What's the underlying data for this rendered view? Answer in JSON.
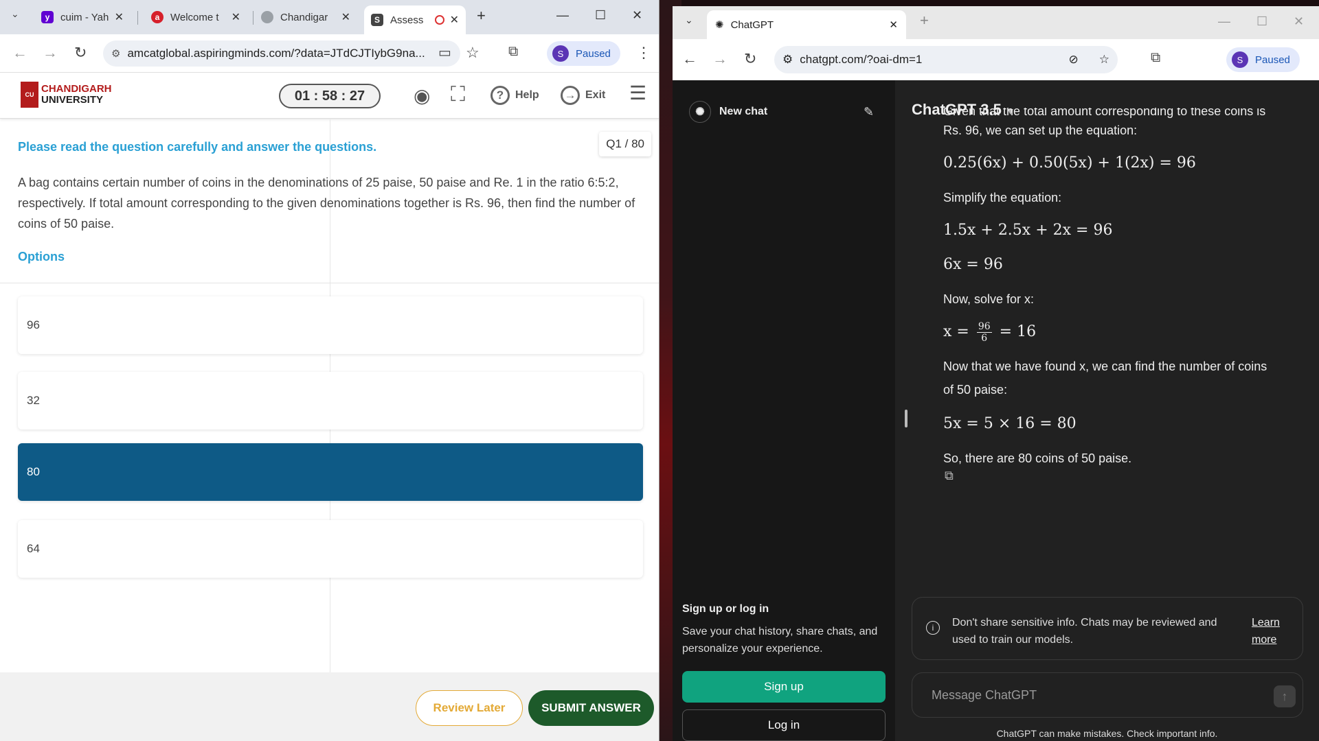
{
  "left_browser": {
    "tabs": [
      {
        "title": "cuim - Yah",
        "icon": "yahoo-icon"
      },
      {
        "title": "Welcome t",
        "icon": "aspiring-minds-icon"
      },
      {
        "title": "Chandigar",
        "icon": "globe-icon"
      },
      {
        "title": "Assess",
        "icon": "s-icon",
        "active": true
      }
    ],
    "url": "amcatglobal.aspiringminds.com/?data=JTdCJTIybG9na...",
    "profile_initial": "S",
    "profile_status": "Paused"
  },
  "exam": {
    "logo_line1": "CHANDIGARH",
    "logo_line2": "UNIVERSITY",
    "logo_mark": "CU",
    "timer": "01 : 58 : 27",
    "help_label": "Help",
    "exit_label": "Exit",
    "instruction": "Please read the question carefully and answer the questions.",
    "question_number": "Q1 / 80",
    "question_text": "A bag contains certain number of coins in the denominations of 25 paise, 50 paise and Re. 1 in the ratio 6:5:2, respectively. If total amount corresponding to the given denominations together is Rs. 96, then find the number of coins of 50 paise.",
    "options_label": "Options",
    "options": [
      "96",
      "32",
      "80",
      "64"
    ],
    "selected_option": "80",
    "review_label": "Review Later",
    "submit_label": "SUBMIT ANSWER",
    "colors": {
      "accent": "#2aa0d4",
      "selected": "#0e5a86",
      "submit": "#1d5a2a",
      "review": "#e3a935"
    }
  },
  "right_browser": {
    "tab_title": "ChatGPT",
    "url": "chatgpt.com/?oai-dm=1",
    "profile_initial": "S",
    "profile_status": "Paused"
  },
  "chatgpt": {
    "new_chat_label": "New chat",
    "model_label": "ChatGPT 3.5",
    "messages": {
      "cut_line": "Given that the total amount corresponding to these coins is",
      "line1": "Rs. 96, we can set up the equation:",
      "eq1": "0.25(6x) + 0.50(5x) + 1(2x) = 96",
      "line2": "Simplify the equation:",
      "eq2": "1.5x + 2.5x + 2x = 96",
      "eq3": "6x = 96",
      "line3": "Now, solve for x:",
      "eq4_left": "x =",
      "eq4_num": "96",
      "eq4_den": "6",
      "eq4_right": "= 16",
      "line4a": "Now that we have found x, we can find the number of coins",
      "line4b": "of 50 paise:",
      "eq5": "5x = 5 × 16 = 80",
      "line5": "So, there are 80 coins of 50 paise."
    },
    "signup_title": "Sign up or log in",
    "signup_desc": "Save your chat history, share chats, and personalize your experience.",
    "signup_label": "Sign up",
    "login_label": "Log in",
    "notice_text": "Don't share sensitive info. Chats may be reviewed and used to train our models.",
    "learn_more": "Learn more",
    "composer_placeholder": "Message ChatGPT",
    "disclaimer": "ChatGPT can make mistakes. Check important info."
  }
}
